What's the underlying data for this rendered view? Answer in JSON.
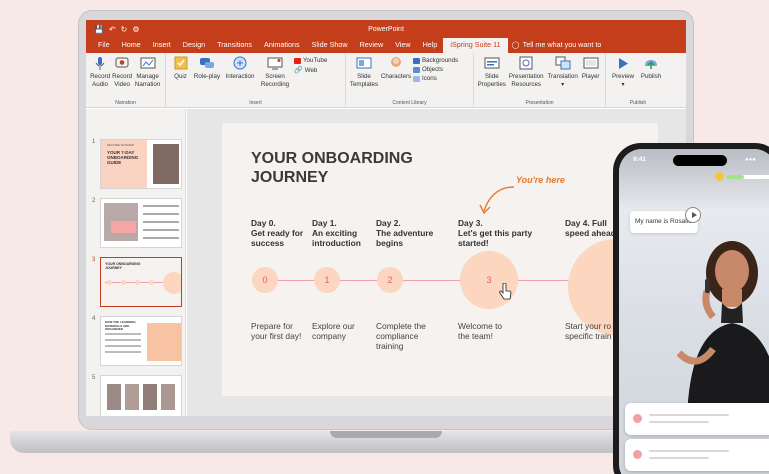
{
  "app": {
    "title": "PowerPoint",
    "menu": [
      "File",
      "Home",
      "Insert",
      "Design",
      "Transitions",
      "Animations",
      "Slide Show",
      "Review",
      "View",
      "Help"
    ],
    "active_tab": "iSpring Suite 11",
    "tell_me": "Tell me what you want to"
  },
  "ribbon": {
    "narration": {
      "label": "Narration",
      "record_audio": [
        "Record",
        "Audio"
      ],
      "record_video": [
        "Record",
        "Video"
      ],
      "manage_narration": [
        "Manage",
        "Narration"
      ]
    },
    "insert": {
      "label": "Insert",
      "quiz": "Quiz",
      "role_play": "Role-play",
      "interaction": "Interaction",
      "screen_recording": [
        "Screen",
        "Recording"
      ],
      "youtube": "YouTube",
      "web": "Web"
    },
    "content_library": {
      "label": "Content Library",
      "slide_templates": [
        "Slide",
        "Templates"
      ],
      "characters": "Characters",
      "backgrounds": "Backgrounds",
      "objects": "Objects",
      "icons": "Icons"
    },
    "presentation": {
      "label": "Presentation",
      "slide_properties": [
        "Slide",
        "Properties"
      ],
      "presentation_resources": [
        "Presentation",
        "Resources"
      ],
      "translation": "Translation",
      "player": "Player"
    },
    "publish": {
      "label": "Publish",
      "preview": "Preview",
      "publish": "Publish"
    }
  },
  "thumbnails": {
    "numbers": [
      "1",
      "2",
      "3",
      "4",
      "5"
    ],
    "t1_title": "YOUR 7-DAY ONBOARDING GUIDE",
    "t1_tag": "WELCOME ON BOARD",
    "t3_title": "YOUR ONBOARDING JOURNEY",
    "t4_title": "HOW THE LEARNING MATERIALS ARE ORGANIZED"
  },
  "slide": {
    "title": "YOUR ONBOARDING JOURNEY",
    "annotation": "You're here",
    "days": [
      {
        "title": "Day 0.\nGet ready for\nsuccess",
        "num": "0",
        "desc": "Prepare for\nyour first day!"
      },
      {
        "title": "Day 1.\nAn exciting\nintroduction",
        "num": "1",
        "desc": "Explore our\ncompany"
      },
      {
        "title": "Day 2.\nThe adventure\nbegins",
        "num": "2",
        "desc": "Complete the\ncompliance\ntraining"
      },
      {
        "title": "Day 3.\nLet's get this party\nstarted!",
        "num": "3",
        "desc": "Welcome to\nthe team!"
      },
      {
        "title": "Day 4. Full\nspeed ahead",
        "num": "",
        "desc": "Start your ro\nspecific train"
      }
    ]
  },
  "phone": {
    "time": "9:41",
    "bubble": "My name is Rosalie",
    "colors": {
      "accent": "#c43e1c",
      "progress": "#a5e38a"
    }
  }
}
